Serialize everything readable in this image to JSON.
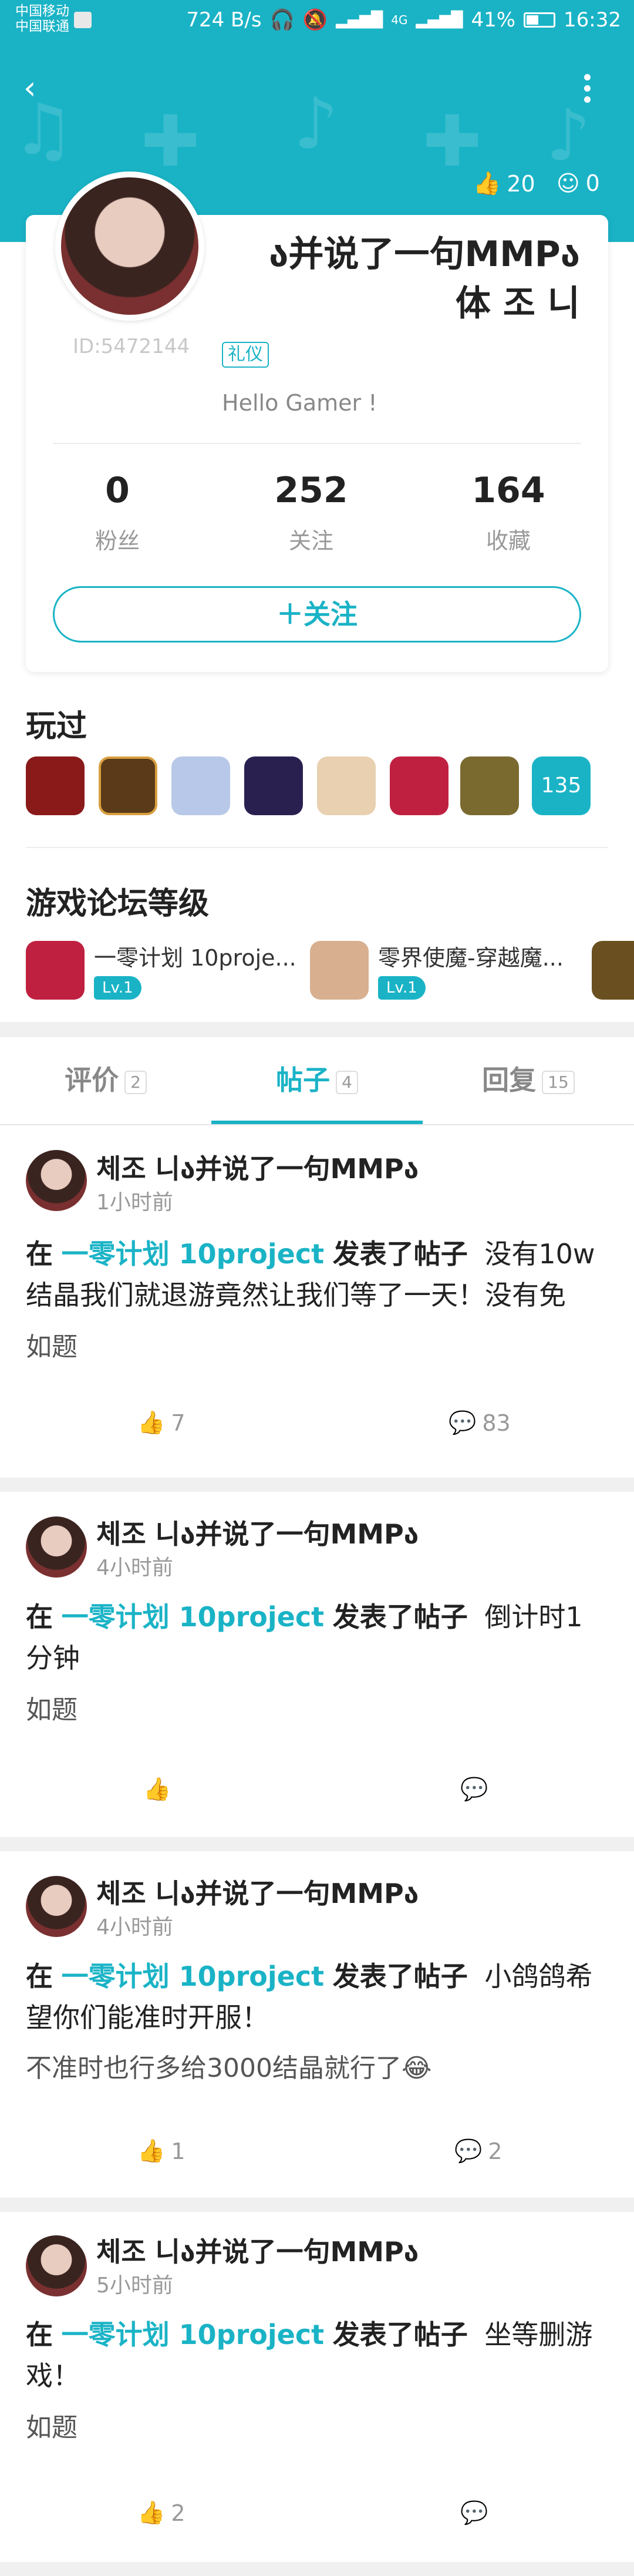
{
  "status_bar": {
    "carrier1": "中国移动",
    "carrier2": "中国联通",
    "speed": "724 B/s",
    "network": "4G",
    "battery": "41%",
    "time": "16:32"
  },
  "header": {
    "likes": "20",
    "smiles": "0"
  },
  "profile": {
    "name_line1": "ა并说了一句MMPა",
    "name_line2": "体 조 니",
    "user_id": "ID:5472144",
    "tag": "礼仪",
    "bio": "Hello Gamer !",
    "stats": [
      {
        "value": "0",
        "label": "粉丝"
      },
      {
        "value": "252",
        "label": "关注"
      },
      {
        "value": "164",
        "label": "收藏"
      }
    ],
    "follow_label": "＋关注"
  },
  "played": {
    "title": "玩过",
    "count": "135",
    "icon_colors": [
      "#8a1a1a",
      "#5a3a18",
      "#b8c8e8",
      "#2a2050",
      "#6a3010",
      "#c02040",
      "#7a6a30"
    ]
  },
  "forum": {
    "title": "游戏论坛等级",
    "items": [
      {
        "name": "一零计划 10proje...",
        "level": "Lv.1",
        "color": "#c02040"
      },
      {
        "name": "零界使魔-穿越魔...",
        "level": "Lv.1",
        "color": "#d8b090"
      }
    ]
  },
  "tabs": [
    {
      "label": "评价",
      "count": "2"
    },
    {
      "label": "帖子",
      "count": "4"
    },
    {
      "label": "回复",
      "count": "15"
    }
  ],
  "posts": [
    {
      "author": "체조 니ა并说了一句MMPა",
      "time": "1小时前",
      "prefix": "在",
      "game": "一零计划 10project",
      "action": "发表了帖子",
      "title": "没有10w结晶我们就退游竟然让我们等了一天！没有免",
      "body": "如题",
      "likes": "7",
      "comments": "83"
    },
    {
      "author": "체조 니ა并说了一句MMPა",
      "time": "4小时前",
      "prefix": "在",
      "game": "一零计划 10project",
      "action": "发表了帖子",
      "title": "倒计时1分钟",
      "body": "如题",
      "likes": "",
      "comments": ""
    },
    {
      "author": "체조 니ა并说了一句MMPა",
      "time": "4小时前",
      "prefix": "在",
      "game": "一零计划 10project",
      "action": "发表了帖子",
      "title": "小鸽鸽希望你们能准时开服！",
      "body": "不准时也行多给3000结晶就行了😂",
      "likes": "1",
      "comments": "2"
    },
    {
      "author": "체조 니ა并说了一句MMPა",
      "time": "5小时前",
      "prefix": "在",
      "game": "一零计划 10project",
      "action": "发表了帖子",
      "title": "坐等删游戏！",
      "body": "如题",
      "likes": "2",
      "comments": ""
    }
  ]
}
